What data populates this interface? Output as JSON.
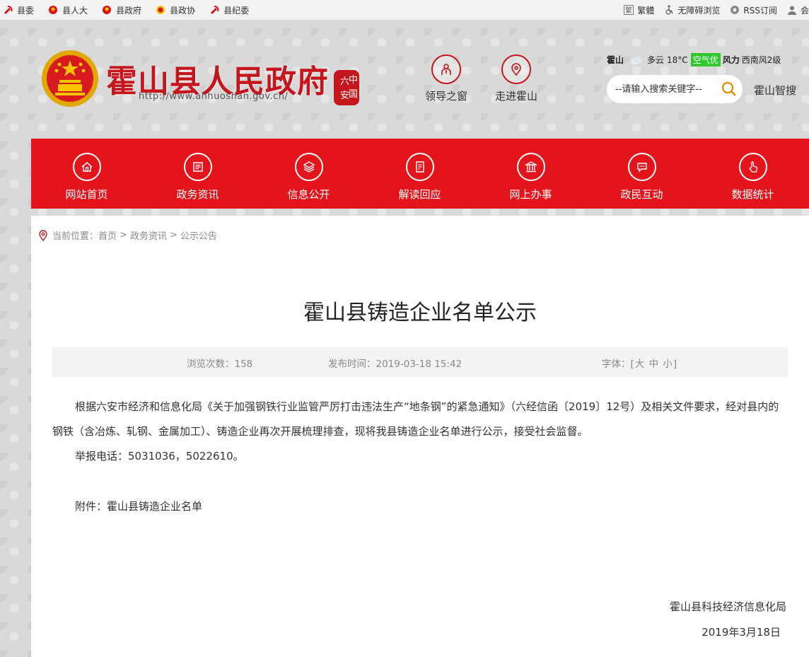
{
  "topbar": {
    "links": [
      {
        "label": "县委",
        "icon": "party-emblem-icon"
      },
      {
        "label": "县人大",
        "icon": "national-emblem-icon"
      },
      {
        "label": "县政府",
        "icon": "national-emblem-icon"
      },
      {
        "label": "县政协",
        "icon": "cppcc-emblem-icon"
      },
      {
        "label": "县纪委",
        "icon": "party-emblem-icon"
      }
    ],
    "right": [
      {
        "label": "繁體",
        "icon": "traditional-chinese-icon"
      },
      {
        "label": "无障碍浏览",
        "icon": "accessibility-icon"
      },
      {
        "label": "RSS订阅",
        "icon": "rss-icon"
      },
      {
        "label": "会",
        "icon": "user-icon"
      }
    ]
  },
  "header": {
    "title": "霍山县人民政府",
    "url": "http://www.ahhuoshan.gov.cn/",
    "seal_text": "六安中国",
    "buttons": [
      {
        "label": "领导之窗",
        "icon": "leader-icon"
      },
      {
        "label": "走进霍山",
        "icon": "location-pin-icon"
      }
    ],
    "weather": {
      "city": "霍山",
      "condition": "多云",
      "temp": "18°C",
      "aqi": "空气优",
      "wind_label": "风力",
      "wind": "西南风2级"
    },
    "search": {
      "placeholder": "--请输入搜索关键字--"
    },
    "smart_search": "霍山智搜"
  },
  "nav": [
    {
      "label": "网站首页",
      "icon": "home-icon"
    },
    {
      "label": "政务资讯",
      "icon": "news-icon"
    },
    {
      "label": "信息公开",
      "icon": "layers-icon"
    },
    {
      "label": "解读回应",
      "icon": "document-edit-icon"
    },
    {
      "label": "网上办事",
      "icon": "government-building-icon"
    },
    {
      "label": "政民互动",
      "icon": "chat-bubble-icon"
    },
    {
      "label": "数据统计",
      "icon": "hand-pointer-icon"
    }
  ],
  "breadcrumb": {
    "prefix": "当前位置：",
    "items": [
      "首页",
      "政务资讯",
      "公示公告"
    ],
    "separator": ">"
  },
  "article": {
    "title": "霍山县铸造企业名单公示",
    "views": "浏览次数：158",
    "published": "发布时间：2019-03-18 15:42",
    "font_label": "字体：[",
    "font_sizes": [
      "大",
      "中",
      "小"
    ],
    "font_close": "]",
    "paragraph1": "根据六安市经济和信息化局《关于加强钢铁行业监管严厉打击违法生产“地条钢”的紧急通知》（六经信函〔2019〕12号）及相关文件要求，经对县内的钢铁（含冶炼、轧钢、金属加工）、铸造企业再次开展梳理排查，现将我县铸造企业名单进行公示，接受社会监督。",
    "paragraph2": "举报电话：5031036，5022610。",
    "attachment_label": "附件：",
    "attachment_name": "霍山县铸造企业名单",
    "signature": "霍山县科技经济信息化局",
    "date": "2019年3月18日"
  },
  "colors": {
    "brand_red": "#e3141b",
    "title_red": "#c4161c",
    "aqi_green": "#2fc82f"
  }
}
